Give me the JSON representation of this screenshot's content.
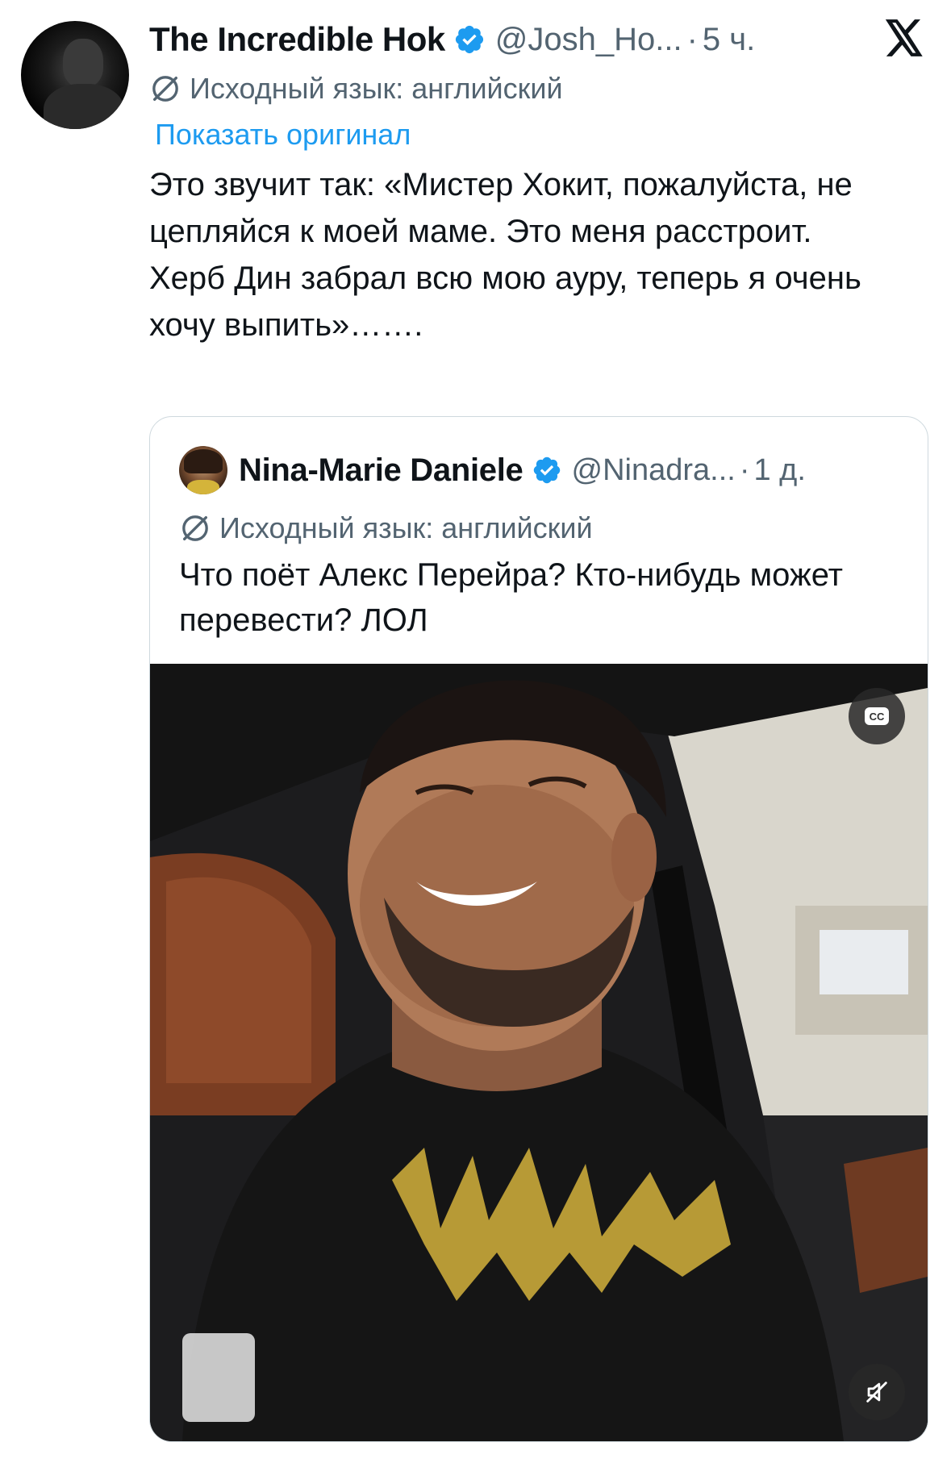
{
  "tweet": {
    "author_name": "The Incredible Hok",
    "handle": "@Josh_Ho...",
    "separator": "·",
    "time": "5 ч.",
    "language_note": "Исходный язык: английский",
    "show_original": "Показать оригинал",
    "text_lines": [
      "Это звучит так: «Мистер Хокит, пожалуйста, не цепляйся к моей маме. Это меня расстроит.",
      "Херб Дин забрал всю мою ауру, теперь я очень хочу выпить»……."
    ]
  },
  "quote": {
    "author_name": "Nina-Marie Daniele",
    "handle": "@Ninadra...",
    "separator": "·",
    "time": "1 д.",
    "language_note": "Исходный язык: английский",
    "text": "Что поёт Алекс Перейра? Кто-нибудь может перевести? ЛОЛ",
    "video": {
      "cc_label": "CC",
      "icons": [
        "cc-icon",
        "mute-icon"
      ]
    }
  },
  "colors": {
    "accent": "#1d9bf0",
    "secondary_text": "#536471",
    "text": "#0f1419",
    "border": "#cfd9de"
  }
}
